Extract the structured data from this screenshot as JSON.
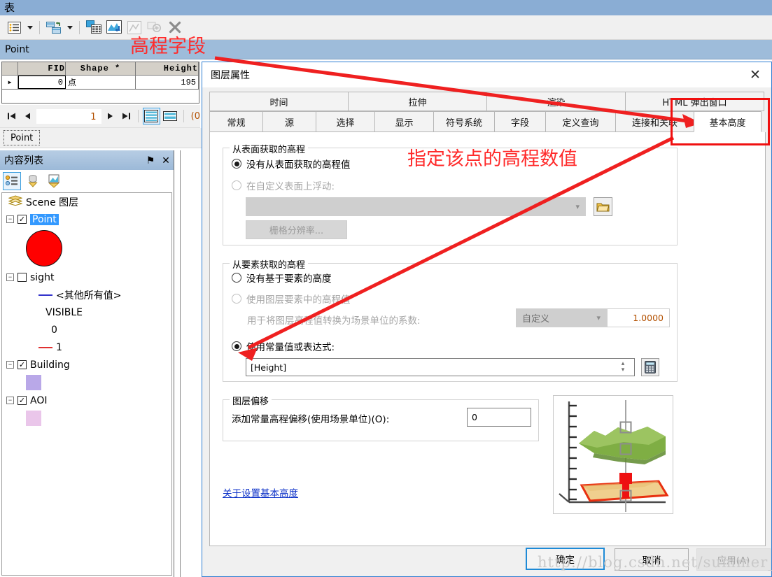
{
  "table_window": {
    "title": "表",
    "toolbar_icons": [
      "table-options-icon",
      "dropdown-caret",
      "related-tables-icon",
      "dropdown-caret-2",
      "select-by-attributes-icon",
      "select-related-icon",
      "zoom-to-selected-icon",
      "zoom-to-selection-icon",
      "clear-selection-icon"
    ],
    "tab_header": "Point",
    "grid": {
      "columns": [
        "",
        "FID",
        "Shape *",
        "Height"
      ],
      "rows": [
        {
          "marker": "▶",
          "fid": "0",
          "shape": "点",
          "height": "195"
        }
      ]
    },
    "nav": {
      "first": "⧏│",
      "prev": "◀",
      "record": "1",
      "next": "▶",
      "last": "│⧐",
      "count_text": "(0",
      "view_all_title": "show-all-records",
      "view_selected_title": "show-selected-records"
    },
    "bottom_tab": "Point"
  },
  "toc": {
    "title": "内容列表",
    "pin_icon": "⚑",
    "close_icon": "✕",
    "tools": [
      "list-by-drawing-order-icon",
      "list-by-source-icon",
      "list-by-visibility-icon"
    ],
    "tree": [
      {
        "type": "root",
        "label": "Scene 图层",
        "icon": "layers-icon"
      },
      {
        "type": "layer",
        "label": "Point",
        "checked": true,
        "selected": true,
        "expander": "−"
      },
      {
        "type": "symbol-circle",
        "color": "#ff0000"
      },
      {
        "type": "layer",
        "label": "sight",
        "checked": false,
        "selected": false,
        "expander": "−"
      },
      {
        "type": "symbol-line",
        "label": "<其他所有值>",
        "color": "#3333cc"
      },
      {
        "type": "symbol-text",
        "label": "VISIBLE"
      },
      {
        "type": "symbol-text2",
        "label": "0"
      },
      {
        "type": "symbol-line",
        "label": "1",
        "color": "#e03030"
      },
      {
        "type": "layer",
        "label": "Building",
        "checked": true,
        "selected": false,
        "expander": "−"
      },
      {
        "type": "symbol-box",
        "color": "#b9a8e8"
      },
      {
        "type": "layer",
        "label": "AOI",
        "checked": true,
        "selected": false,
        "expander": "−"
      },
      {
        "type": "symbol-box",
        "color": "#eac6ea"
      }
    ]
  },
  "dialog": {
    "title": "图层属性",
    "close_icon": "✕",
    "tabs_row1": [
      "时间",
      "拉伸",
      "渲染",
      "HTML 弹出窗口"
    ],
    "tabs_row2": [
      "常规",
      "源",
      "选择",
      "显示",
      "符号系统",
      "字段",
      "定义查询",
      "连接和关联",
      "基本高度"
    ],
    "active_tab": "基本高度",
    "group_surface": {
      "title": "从表面获取的高程",
      "radio_none": {
        "label": "没有从表面获取的高程值",
        "checked": true
      },
      "radio_float": {
        "label": "在自定义表面上浮动:",
        "checked": false,
        "disabled": true
      },
      "surface_combo_value": "",
      "folder_button": "open-folder-icon",
      "raster_resolution_button": "栅格分辨率..."
    },
    "group_feature": {
      "title": "从要素获取的高程",
      "radio_no_feature": {
        "label": "没有基于要素的高度",
        "checked": false
      },
      "radio_use_layer": {
        "label": "使用图层要素中的高程值",
        "checked": false,
        "disabled": true
      },
      "factor_label": "用于将图层高程值转换为场景单位的系数:",
      "factor_combo_value": "自定义",
      "factor_value": "1.0000",
      "radio_constant": {
        "label": "使用常量值或表达式:",
        "checked": true
      },
      "expression_value": "[Height]",
      "calculator_button": "calculator-icon"
    },
    "group_offset": {
      "title": "图层偏移",
      "label": "添加常量高程偏移(使用场景单位)(O):",
      "value": "0"
    },
    "help_link": "关于设置基本高度",
    "preview_alt": "elevation-preview-illustration",
    "buttons": {
      "ok": "确定",
      "cancel": "取消",
      "apply": "应用(A)"
    }
  },
  "annotations": {
    "note_elevation_field": "高程字段",
    "note_specify_value": "指定该点的高程数值",
    "highlight_box": "red-highlight-basic-height-tab"
  },
  "watermark": "http://blog.csdn.net/summer_dew",
  "colors": {
    "titlebar": "#8aadd4",
    "tab_header": "#9ebcda",
    "accent_blue": "#3399ff",
    "annotation_red": "#ff2a2a",
    "link_blue": "#0d32c8",
    "point_symbol": "#ff0000"
  }
}
